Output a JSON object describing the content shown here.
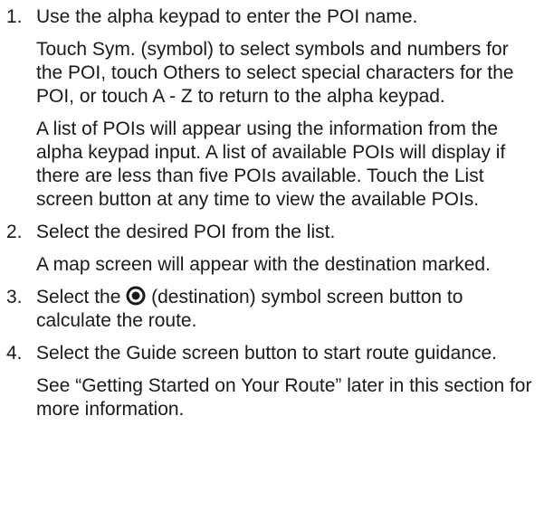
{
  "steps": [
    {
      "number": "1.",
      "text": "Use the alpha keypad to enter the POI name.",
      "notes": [
        "Touch Sym. (symbol) to select symbols and numbers for the POI, touch Others to select special characters for the POI, or touch A - Z to return to the alpha keypad.",
        "A list of POIs will appear using the information from the alpha keypad input. A list of available POIs will display if there are less than five POIs available. Touch the List screen button at any time to view the available POIs."
      ]
    },
    {
      "number": "2.",
      "text": "Select the desired POI from the list.",
      "notes": [
        "A map screen will appear with the destination marked."
      ]
    },
    {
      "number": "3.",
      "text_before_icon": "Select the",
      "icon": "destination-icon",
      "text_after_icon": "(destination) symbol screen button to calculate the route."
    },
    {
      "number": "4.",
      "text": "Select the Guide screen button to start route guidance.",
      "notes": [
        "See “Getting Started on Your Route” later in this section for more information."
      ]
    }
  ]
}
